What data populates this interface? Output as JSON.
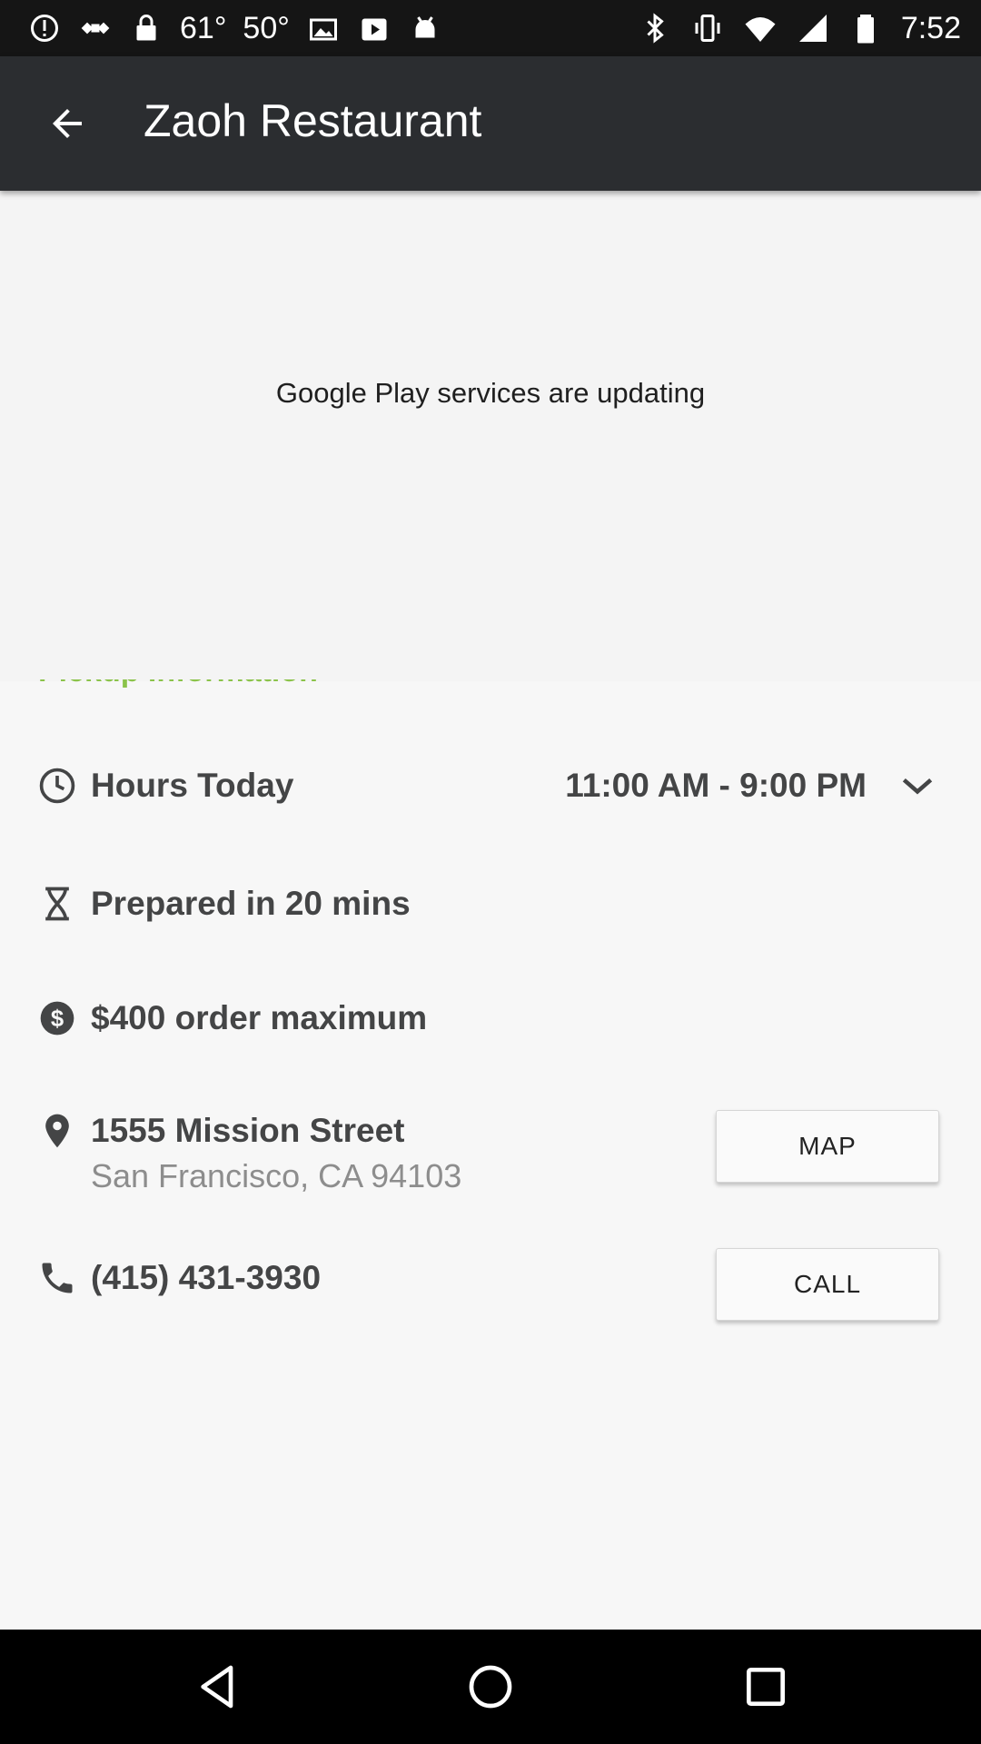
{
  "status_bar": {
    "temp1": "61°",
    "temp2": "50°",
    "time": "7:52",
    "icons": [
      "alert-icon",
      "fake-gps-icon",
      "lock-icon",
      "image-icon",
      "play-store-icon",
      "android-icon",
      "bluetooth-icon",
      "vibrate-icon",
      "wifi-icon",
      "signal-icon",
      "battery-icon"
    ]
  },
  "app_bar": {
    "title": "Zaoh Restaurant",
    "back_icon": "arrow-back-icon"
  },
  "banner": {
    "message": "Google Play services are updating"
  },
  "pickup": {
    "section_title": "Pickup Information",
    "hours_label": "Hours Today",
    "hours_value": "11:00 AM - 9:00 PM",
    "prepared": "Prepared in 20 mins",
    "order_max": "$400 order maximum",
    "address_line1": "1555 Mission Street",
    "address_line2": "San Francisco, CA 94103",
    "map_button": "MAP",
    "phone": "(415) 431-3930",
    "call_button": "CALL"
  },
  "colors": {
    "app_bar": "#2b2d30",
    "accent_green": "#8bc34a",
    "content_bg": "#f7f7f7"
  }
}
